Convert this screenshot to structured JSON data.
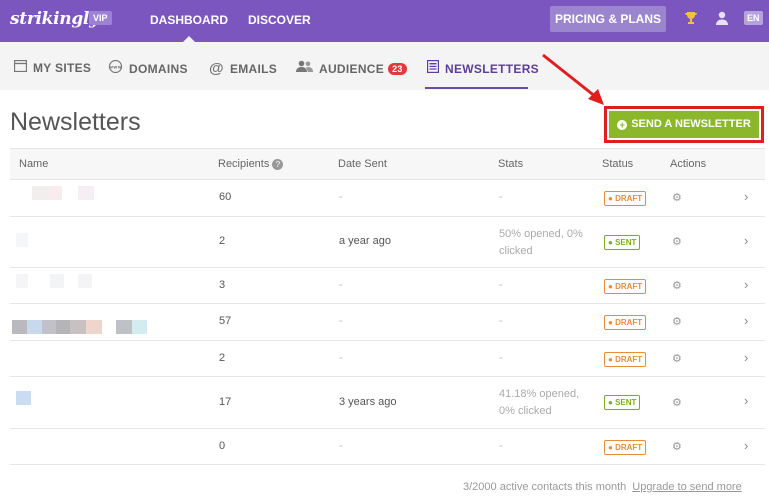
{
  "header": {
    "logo": "strikingly",
    "vip": "VIP",
    "nav": [
      "DASHBOARD",
      "DISCOVER"
    ],
    "pricing": "PRICING & PLANS",
    "lang": "EN",
    "icons": [
      "trophy-icon",
      "user-icon"
    ]
  },
  "subnav": {
    "items": [
      {
        "label": "MY SITES",
        "icon": "browser-window-icon"
      },
      {
        "label": "DOMAINS",
        "icon": "www-icon"
      },
      {
        "label": "EMAILS",
        "icon": "at-icon"
      },
      {
        "label": "AUDIENCE",
        "icon": "users-icon",
        "badge": "23"
      },
      {
        "label": "NEWSLETTERS",
        "icon": "newsletter-icon"
      }
    ],
    "active": "NEWSLETTERS"
  },
  "page": {
    "title": "Newsletters",
    "send_button": "SEND A NEWSLETTER"
  },
  "table": {
    "columns": [
      "Name",
      "Recipients",
      "Date Sent",
      "Stats",
      "Status",
      "Actions"
    ],
    "rows": [
      {
        "recipients": "60",
        "date": "-",
        "stats": "-",
        "status": "DRAFT"
      },
      {
        "recipients": "2",
        "date": "a year ago",
        "stats": "50% opened, 0% clicked",
        "status": "SENT"
      },
      {
        "recipients": "3",
        "date": "-",
        "stats": "-",
        "status": "DRAFT"
      },
      {
        "recipients": "57",
        "date": "-",
        "stats": "-",
        "status": "DRAFT"
      },
      {
        "recipients": "2",
        "date": "-",
        "stats": "-",
        "status": "DRAFT"
      },
      {
        "recipients": "17",
        "date": "3 years ago",
        "stats": "41.18% opened, 0% clicked",
        "status": "SENT"
      },
      {
        "recipients": "0",
        "date": "-",
        "stats": "-",
        "status": "DRAFT"
      }
    ]
  },
  "footer": {
    "contacts": "3/2000 active contacts this month",
    "upgrade": "Upgrade to send more"
  },
  "colors": {
    "brand_purple": "#7c56bf",
    "send_green": "#8ab82a",
    "draft_orange": "#e78c3a",
    "sent_green": "#7cae1c",
    "highlight_red": "#e01e1e"
  }
}
